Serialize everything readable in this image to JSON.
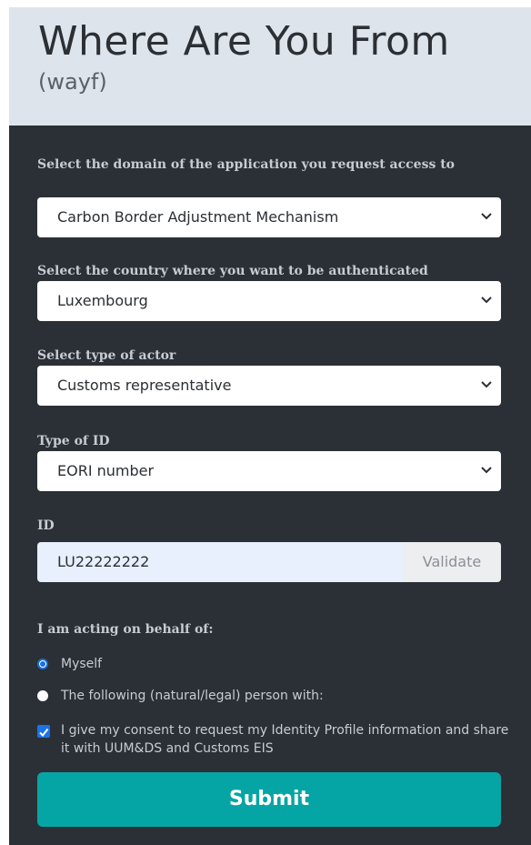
{
  "header": {
    "title": "Where Are You From",
    "subtitle": "(wayf)"
  },
  "form": {
    "domain": {
      "label": "Select the domain of the application you request access to",
      "selected": "Carbon Border Adjustment Mechanism"
    },
    "country": {
      "label": "Select the country where you want to be authenticated",
      "selected": "Luxembourg"
    },
    "actor": {
      "label": "Select type of actor",
      "selected": "Customs representative"
    },
    "id_type": {
      "label": "Type of ID",
      "selected": "EORI number"
    },
    "id": {
      "label": "ID",
      "value": "LU22222222",
      "validate_label": "Validate"
    },
    "behalf": {
      "label": "I am acting on behalf of:",
      "options": [
        {
          "label": "Myself",
          "selected": true
        },
        {
          "label": "The following (natural/legal) person with:",
          "selected": false
        }
      ]
    },
    "consent": {
      "label": "I give my consent to request my Identity Profile information and share it with UUM&DS and Customs EIS",
      "checked": true
    },
    "submit_label": "Submit"
  },
  "colors": {
    "header_bg": "#dde4ec",
    "panel_bg": "#2b3036",
    "accent": "#06a5a5",
    "radio_check": "#1a6fd8"
  }
}
